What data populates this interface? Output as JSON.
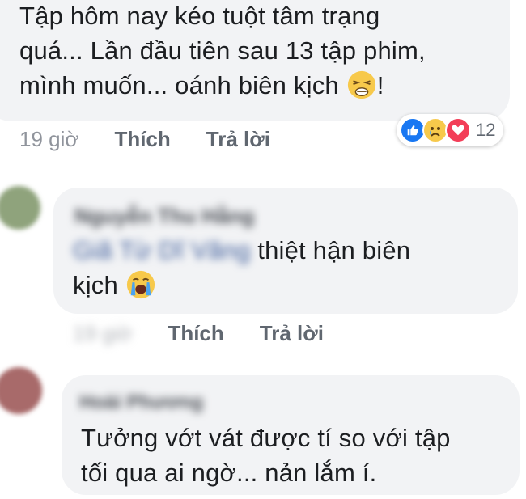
{
  "comment1": {
    "text_line1": "Tập hôm nay kéo tuột tâm trạng",
    "text_line2": "quá... Lần đầu tiên sau 13 tập phim,",
    "text_line3": "mình muốn... oánh biên kịch",
    "text_tail": "!",
    "emoji": "persevering-face-icon",
    "time": "19 giờ",
    "like_label": "Thích",
    "reply_label": "Trả lời",
    "reaction_count": "12",
    "reactions": [
      "like-icon",
      "sad-icon",
      "love-icon"
    ]
  },
  "comment2": {
    "author": "Nguyễn Thu Hằng",
    "mention": "Giã Từ Dĩ Vãng",
    "text_a": "thiệt hận biên",
    "text_b": "kịch",
    "emoji": "crying-face-icon",
    "time": "19 giờ",
    "like_label": "Thích",
    "reply_label": "Trả lời"
  },
  "comment3": {
    "author": "Hoài Phương",
    "text_line1": "Tưởng vớt vát được tí so với tập",
    "text_line2": "tối qua ai ngờ... nản lắm í."
  },
  "colors": {
    "bubble": "#f2f3f5",
    "like_blue": "#1877f2",
    "love_red": "#f33e58",
    "sad_yellow": "#f7c94b",
    "meta_gray": "#90949c"
  }
}
